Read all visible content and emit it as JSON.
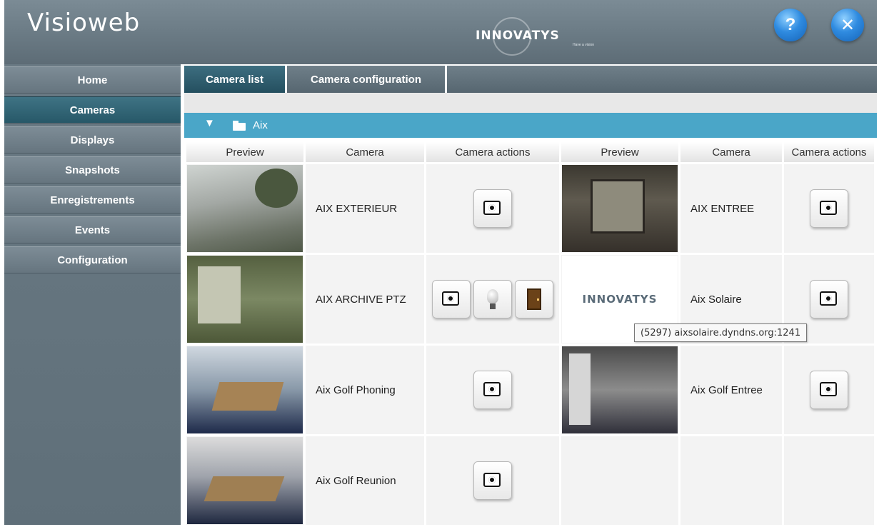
{
  "app": {
    "title": "Visioweb",
    "logo_text": "INNOVATYS",
    "logo_tagline": "Have a vision"
  },
  "header_buttons": {
    "help": "?",
    "close": "✕"
  },
  "sidebar": {
    "items": [
      {
        "label": "Home"
      },
      {
        "label": "Cameras",
        "active": true
      },
      {
        "label": "Displays"
      },
      {
        "label": "Snapshots"
      },
      {
        "label": "Enregistrements"
      },
      {
        "label": "Events"
      },
      {
        "label": "Configuration"
      }
    ]
  },
  "tabs": [
    {
      "label": "Camera list",
      "active": true
    },
    {
      "label": "Camera configuration"
    }
  ],
  "group": {
    "arrow": "▼",
    "name": "Aix"
  },
  "table": {
    "headers": [
      "Preview",
      "Camera",
      "Camera actions",
      "Preview",
      "Camera",
      "Camera actions"
    ],
    "cameras": [
      {
        "name": "AIX EXTERIEUR"
      },
      {
        "name": "AIX ENTREE"
      },
      {
        "name": "AIX ARCHIVE PTZ"
      },
      {
        "name": "Aix Solaire"
      },
      {
        "name": "Aix Golf Phoning"
      },
      {
        "name": "Aix Golf Entree"
      },
      {
        "name": "Aix Golf Reunion"
      }
    ]
  },
  "tooltip": {
    "text": "(5297) aixsolaire.dyndns.org:1241"
  },
  "icons": {
    "snapshot": "camera-icon",
    "light": "bulb-icon",
    "door": "door-icon",
    "help": "question-icon",
    "close": "close-icon",
    "folder": "folder-icon"
  }
}
